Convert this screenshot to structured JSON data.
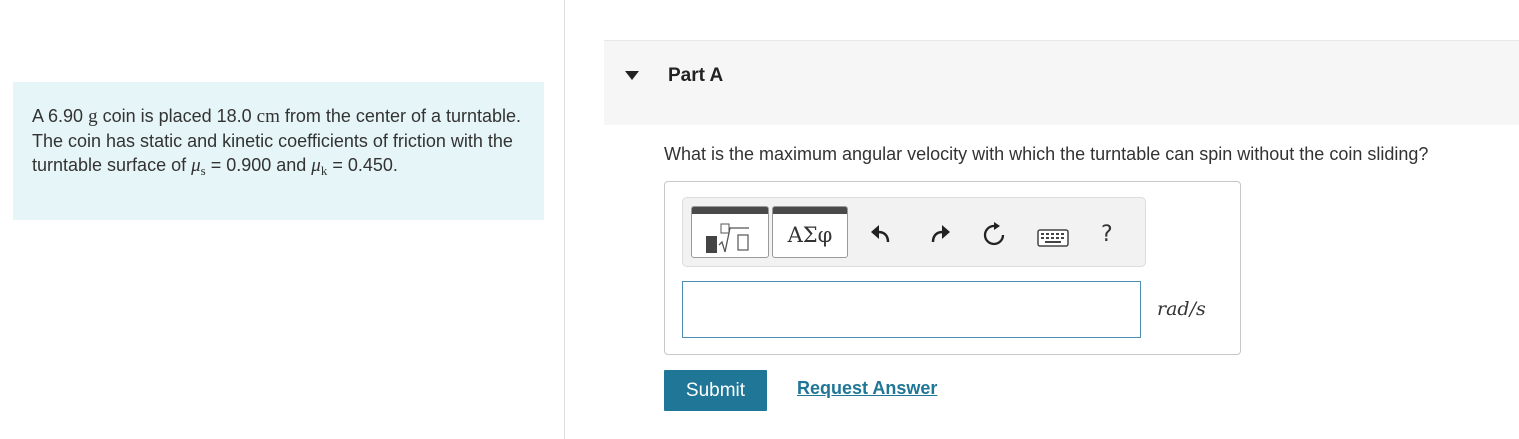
{
  "problem": {
    "t1": "A 6.90 ",
    "u1": "g",
    "t2": " coin is placed 18.0 ",
    "u2": "cm",
    "t3": " from the center of a turntable. The coin has static and kinetic coefficients of friction with the turntable surface of ",
    "mu_s_sym": "μ",
    "mu_s_sub": "s",
    "t4": " = 0.900 and ",
    "mu_k_sym": "μ",
    "mu_k_sub": "k",
    "t5": " = 0.450."
  },
  "part": {
    "title": "Part A",
    "question": "What is the maximum angular velocity with which the turntable can spin without the coin sliding?"
  },
  "toolbar": {
    "greek_label": "ΑΣφ",
    "help_label": "?",
    "icons": [
      "templates-icon",
      "greek-letters-icon",
      "undo-icon",
      "redo-icon",
      "reset-icon",
      "keyboard-icon",
      "help-icon"
    ]
  },
  "answer": {
    "value": "",
    "unit": "rad/s"
  },
  "actions": {
    "submit_label": "Submit",
    "request_label": "Request Answer"
  },
  "colors": {
    "problem_bg": "#e6f5f7",
    "accent": "#1f7696",
    "header_bg": "#f6f6f6",
    "input_border": "#4b8fb5"
  }
}
